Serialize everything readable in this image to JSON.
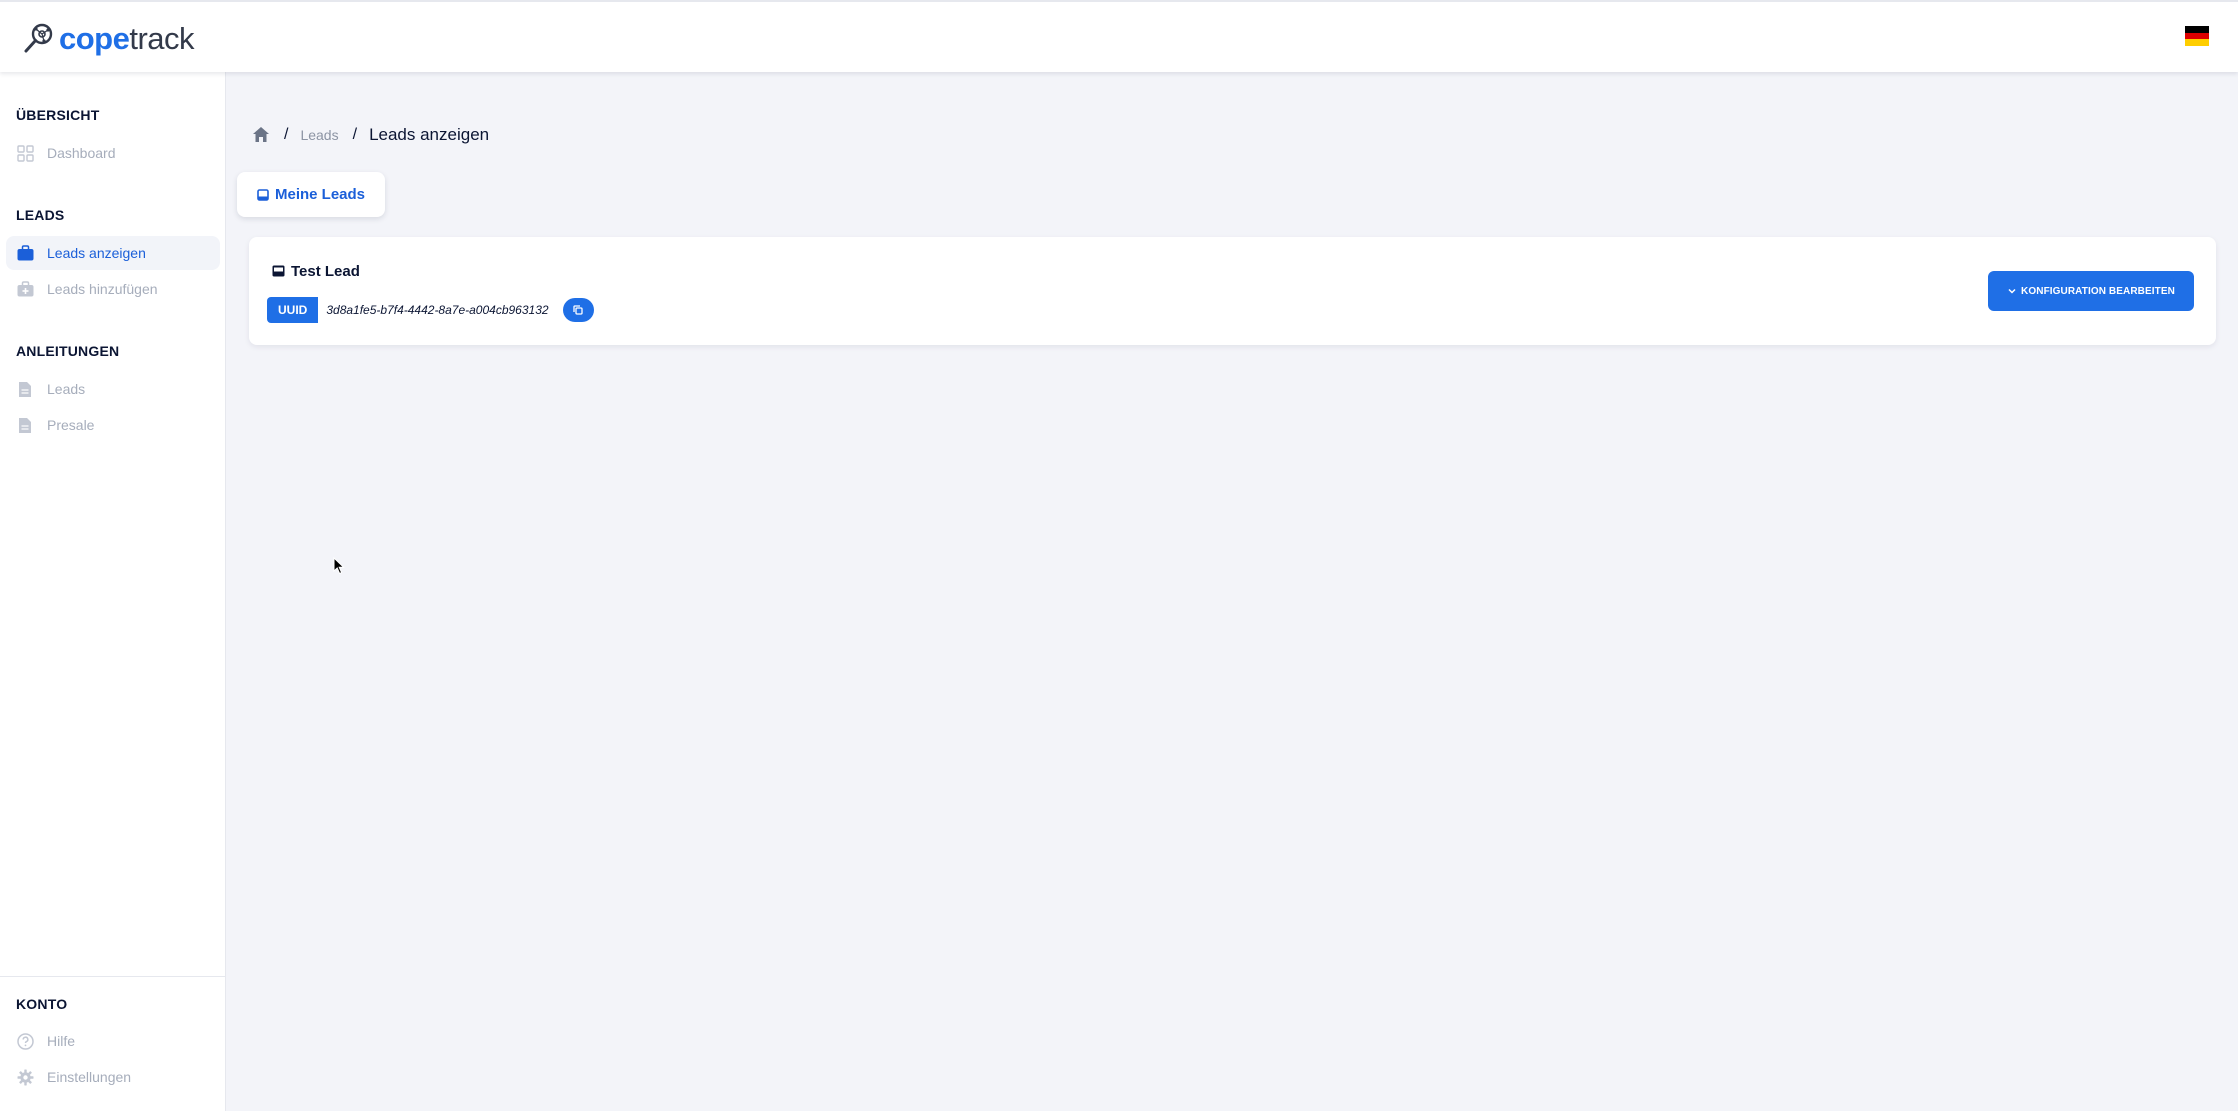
{
  "app": {
    "logo_part1": "cope",
    "logo_part2": "track",
    "brand_color": "#1f6fe6"
  },
  "header": {
    "language_flag": "de-flag-icon"
  },
  "sidebar": {
    "sections": [
      {
        "title": "ÜBERSICHT",
        "items": [
          {
            "label": "Dashboard",
            "icon": "grid-icon",
            "active": false
          }
        ]
      },
      {
        "title": "LEADS",
        "items": [
          {
            "label": "Leads anzeigen",
            "icon": "briefcase-icon",
            "active": true
          },
          {
            "label": "Leads hinzufügen",
            "icon": "briefcase-plus-icon",
            "active": false
          }
        ]
      },
      {
        "title": "ANLEITUNGEN",
        "items": [
          {
            "label": "Leads",
            "icon": "document-icon",
            "active": false
          },
          {
            "label": "Presale",
            "icon": "document-icon",
            "active": false
          }
        ]
      },
      {
        "title": "KONTO",
        "items": [
          {
            "label": "Hilfe",
            "icon": "help-icon",
            "active": false
          },
          {
            "label": "Einstellungen",
            "icon": "gear-icon",
            "active": false
          }
        ]
      }
    ]
  },
  "breadcrumb": {
    "separator": "/",
    "items": [
      "Leads",
      "Leads anzeigen"
    ]
  },
  "tabs": [
    {
      "label": "Meine Leads",
      "active": true
    }
  ],
  "leads": [
    {
      "name": "Test Lead",
      "uuid_label": "UUID",
      "uuid": "3d8a1fe5-b7f4-4442-8a7e-a004cb963132",
      "edit_label": "KONFIGURATION BEARBEITEN"
    }
  ]
}
